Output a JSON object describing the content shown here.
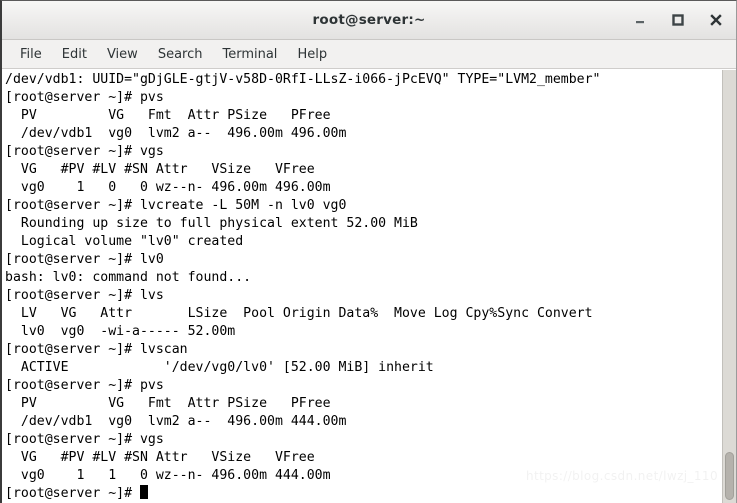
{
  "window": {
    "title": "root@server:~",
    "controls": [
      {
        "name": "minimize",
        "glyph": "minimize-icon"
      },
      {
        "name": "maximize",
        "glyph": "maximize-icon"
      },
      {
        "name": "close",
        "glyph": "close-icon"
      }
    ]
  },
  "menubar": {
    "items": [
      {
        "label": "File"
      },
      {
        "label": "Edit"
      },
      {
        "label": "View"
      },
      {
        "label": "Search"
      },
      {
        "label": "Terminal"
      },
      {
        "label": "Help"
      }
    ]
  },
  "terminal": {
    "prompt": "[root@server ~]#",
    "cursor": "block",
    "foreground": "#000000",
    "background": "#ffffff",
    "lines": [
      "/dev/vdb1: UUID=\"gDjGLE-gtjV-v58D-0RfI-LLsZ-i066-jPcEVQ\" TYPE=\"LVM2_member\"",
      "[root@server ~]# pvs",
      "  PV         VG   Fmt  Attr PSize   PFree",
      "  /dev/vdb1  vg0  lvm2 a--  496.00m 496.00m",
      "[root@server ~]# vgs",
      "  VG   #PV #LV #SN Attr   VSize   VFree",
      "  vg0    1   0   0 wz--n- 496.00m 496.00m",
      "[root@server ~]# lvcreate -L 50M -n lv0 vg0",
      "  Rounding up size to full physical extent 52.00 MiB",
      "  Logical volume \"lv0\" created",
      "[root@server ~]# lv0",
      "bash: lv0: command not found...",
      "[root@server ~]# lvs",
      "  LV   VG   Attr       LSize  Pool Origin Data%  Move Log Cpy%Sync Convert",
      "  lv0  vg0  -wi-a----- 52.00m",
      "[root@server ~]# lvscan",
      "  ACTIVE            '/dev/vg0/lv0' [52.00 MiB] inherit",
      "[root@server ~]# pvs",
      "  PV         VG   Fmt  Attr PSize   PFree",
      "  /dev/vdb1  vg0  lvm2 a--  496.00m 444.00m",
      "[root@server ~]# vgs",
      "  VG   #PV #LV #SN Attr   VSize   VFree",
      "  vg0    1   1   0 wz--n- 496.00m 444.00m"
    ],
    "last_prompt": "[root@server ~]# "
  },
  "scrollbar": {
    "orientation": "vertical",
    "thumb_position_percent": 88
  },
  "watermark": {
    "text": "https://blog.csdn.net/lwzj_110"
  }
}
